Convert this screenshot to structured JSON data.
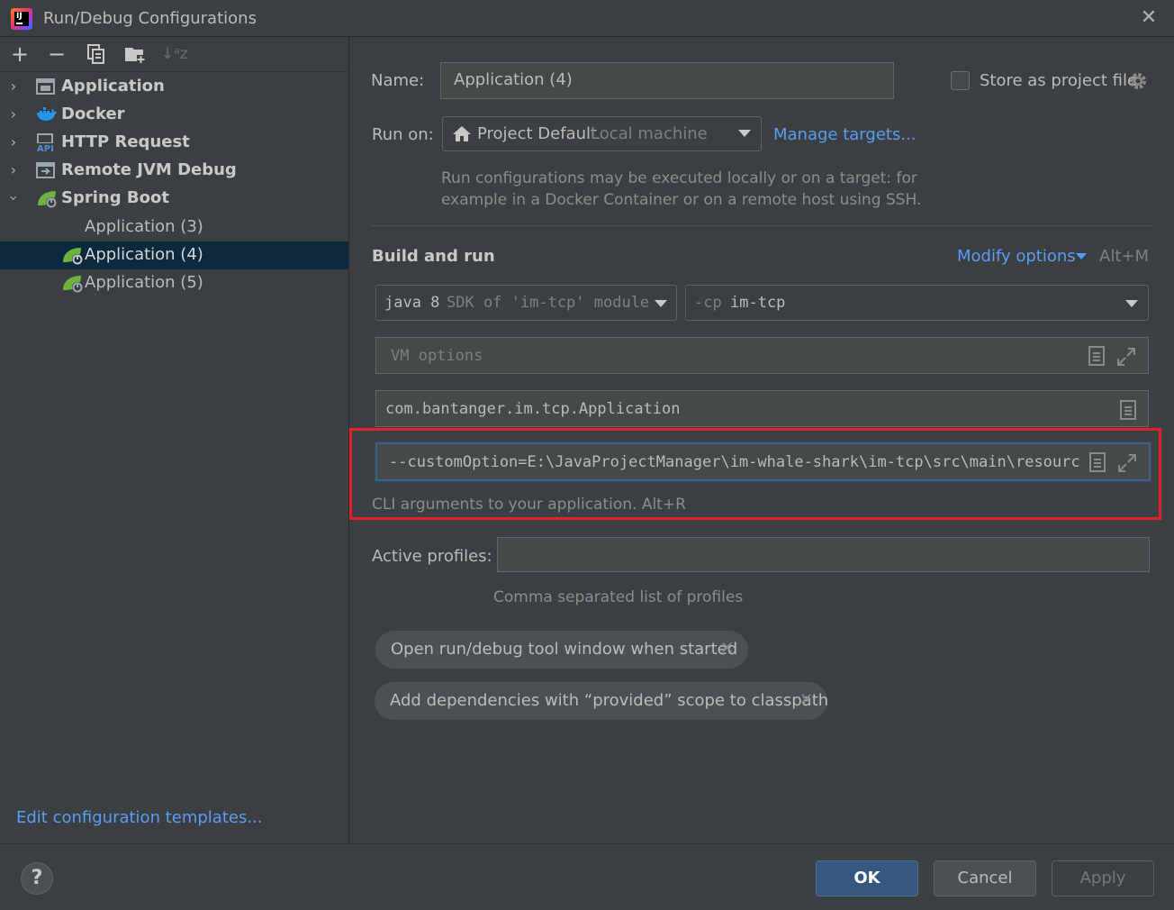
{
  "window": {
    "title": "Run/Debug Configurations",
    "close_glyph": "✕"
  },
  "toolbar": {
    "add": "+",
    "remove": "−",
    "sort_glyph": "↓ᵃz"
  },
  "tree": {
    "items": [
      {
        "label": "Application",
        "icon": "application-icon"
      },
      {
        "label": "Docker",
        "icon": "docker-icon"
      },
      {
        "label": "HTTP Request",
        "icon": "api-icon",
        "badge": "API"
      },
      {
        "label": "Remote JVM Debug",
        "icon": "remote-debug-icon"
      },
      {
        "label": "Spring Boot",
        "icon": "spring-boot-icon"
      },
      {
        "label": "Application (3)",
        "icon": "none"
      },
      {
        "label": "Application (4)",
        "icon": "spring-boot-icon",
        "selected": true
      },
      {
        "label": "Application (5)",
        "icon": "spring-boot-icon"
      }
    ]
  },
  "left_footer": {
    "edit_templates": "Edit configuration templates..."
  },
  "form": {
    "name_label": "Name:",
    "name_value": "Application (4)",
    "store_label": "Store as project file",
    "run_on_label": "Run on:",
    "run_on_value": "Project Default",
    "run_on_hint": "Local machine",
    "manage_targets": "Manage targets...",
    "run_on_desc_1": "Run configurations may be executed locally or on a target: for",
    "run_on_desc_2": "example in a Docker Container or on a remote host using SSH.",
    "build_run_title": "Build and run",
    "modify_options": "Modify options",
    "modify_shortcut": "Alt+M",
    "jdk_main": "java 8",
    "jdk_detail": "SDK of 'im-tcp' module",
    "cp_prefix": "-cp",
    "cp_value": "im-tcp",
    "vm_placeholder": "VM options",
    "main_class": "com.bantanger.im.tcp.Application",
    "program_args": "--customOption=E:\\JavaProjectManager\\im-whale-shark\\im-tcp\\src\\main\\resources",
    "program_args_hint": "CLI arguments to your application. Alt+R",
    "profiles_label": "Active profiles:",
    "profiles_value": "",
    "profiles_hint": "Comma separated list of profiles",
    "chip_1": "Open run/debug tool window when started",
    "chip_2": "Add dependencies with “provided” scope to classpath",
    "chip_close": "✕"
  },
  "buttons": {
    "help": "?",
    "ok": "OK",
    "cancel": "Cancel",
    "apply": "Apply"
  },
  "colors": {
    "accent": "#589df6",
    "highlight": "#e0202a",
    "spring": "#6db33f",
    "selection": "#0d293e"
  }
}
